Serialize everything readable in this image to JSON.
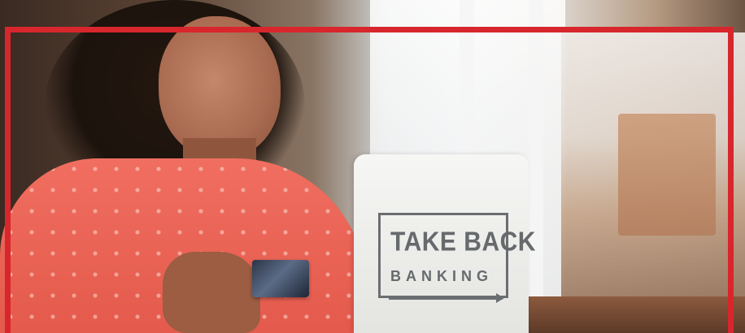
{
  "hero": {
    "frame_color": "#d8262d",
    "logo": {
      "line1": "TAKE BACK",
      "line2": "BANKING"
    }
  }
}
